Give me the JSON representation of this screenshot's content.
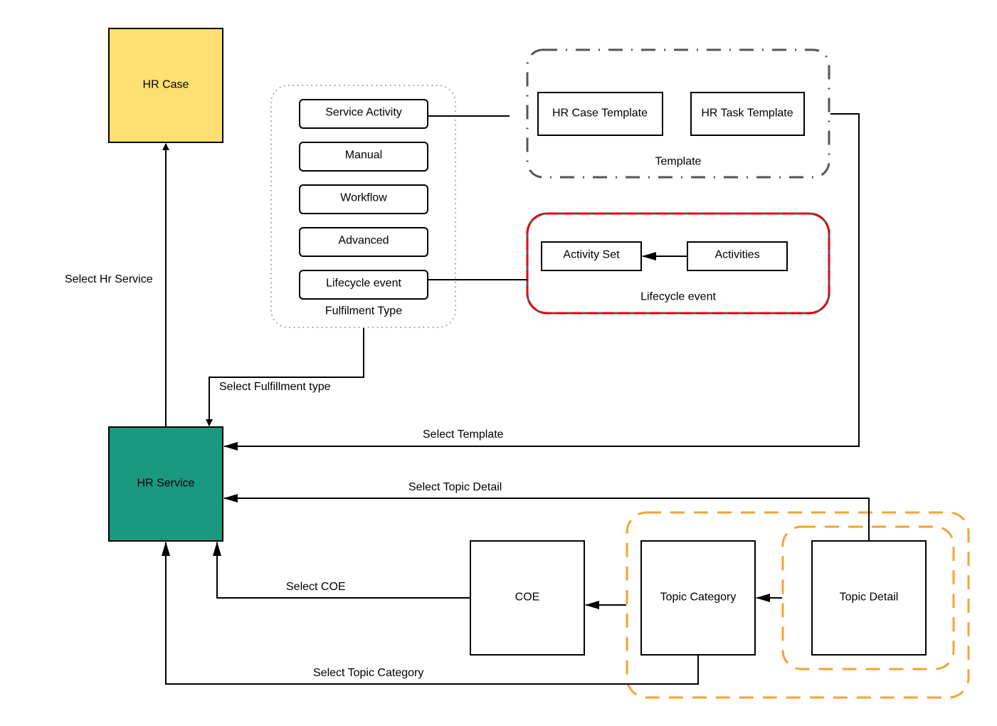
{
  "diagram": {
    "nodes": {
      "hr_case": {
        "label": "HR Case",
        "fill": "#FFDF71"
      },
      "hr_service": {
        "label": "HR Service",
        "fill": "#1A9880"
      },
      "coe": {
        "label": "COE"
      },
      "topic_category": {
        "label": "Topic Category"
      },
      "topic_detail": {
        "label": "Topic Detail"
      }
    },
    "fulfilment_group": {
      "title": "Fulfilment Type",
      "items": [
        {
          "label": "Service Activity"
        },
        {
          "label": "Manual"
        },
        {
          "label": "Workflow"
        },
        {
          "label": "Advanced"
        },
        {
          "label": "Lifecycle event"
        }
      ]
    },
    "template_group": {
      "title": "Template",
      "items": [
        {
          "label": "HR Case Template"
        },
        {
          "label": "HR Task Template"
        }
      ]
    },
    "lifecycle_group": {
      "title": "Lifecycle event",
      "items": [
        {
          "label": "Activity Set"
        },
        {
          "label": "Activities"
        }
      ]
    },
    "edge_labels": {
      "select_hr_service": "Select Hr Service",
      "select_fulfillment_type": "Select Fulfillment type",
      "select_template": "Select Template",
      "select_topic_detail": "Select Topic Detail",
      "select_coe": "Select COE",
      "select_topic_category": "Select Topic Category"
    },
    "colors": {
      "topic_group_border": "#F7A235",
      "lifecycle_group_red": "#E8000B",
      "lifecycle_group_gray": "#555555",
      "template_group_border": "#555555"
    }
  }
}
